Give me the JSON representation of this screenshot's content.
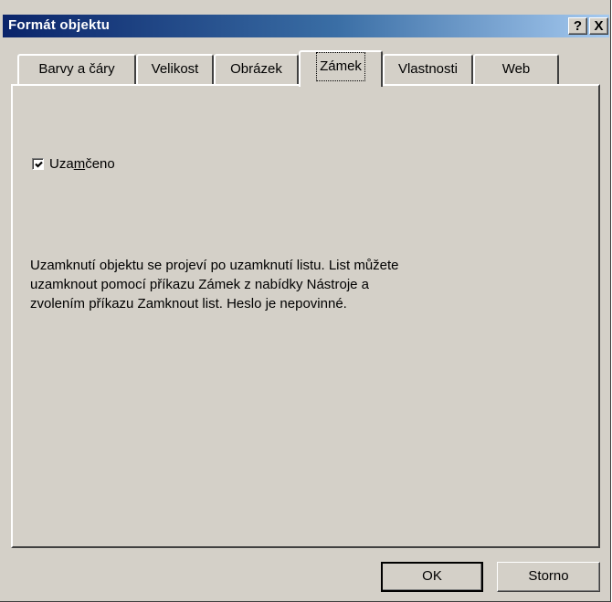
{
  "window": {
    "title": "Formát objektu",
    "help_glyph": "?",
    "close_glyph": "X"
  },
  "tabs": [
    {
      "label": "Barvy a čáry",
      "active": false
    },
    {
      "label": "Velikost",
      "active": false
    },
    {
      "label": "Obrázek",
      "active": false
    },
    {
      "label": "Zámek",
      "active": true
    },
    {
      "label": "Vlastnosti",
      "active": false
    },
    {
      "label": "Web",
      "active": false
    }
  ],
  "lock": {
    "label_pre": "Uza",
    "label_mnemonic": "m",
    "label_post": "čeno",
    "checked": true
  },
  "info_text": "Uzamknutí objektu se projeví po uzamknutí listu. List můžete uzamknout pomocí příkazu Zámek z nabídky Nástroje a zvolením příkazu Zamknout list. Heslo je nepovinné.",
  "buttons": {
    "ok": "OK",
    "cancel": "Storno"
  },
  "colors": {
    "face": "#d4d0c8",
    "title_start": "#0a246a",
    "title_end": "#a6caf0"
  }
}
